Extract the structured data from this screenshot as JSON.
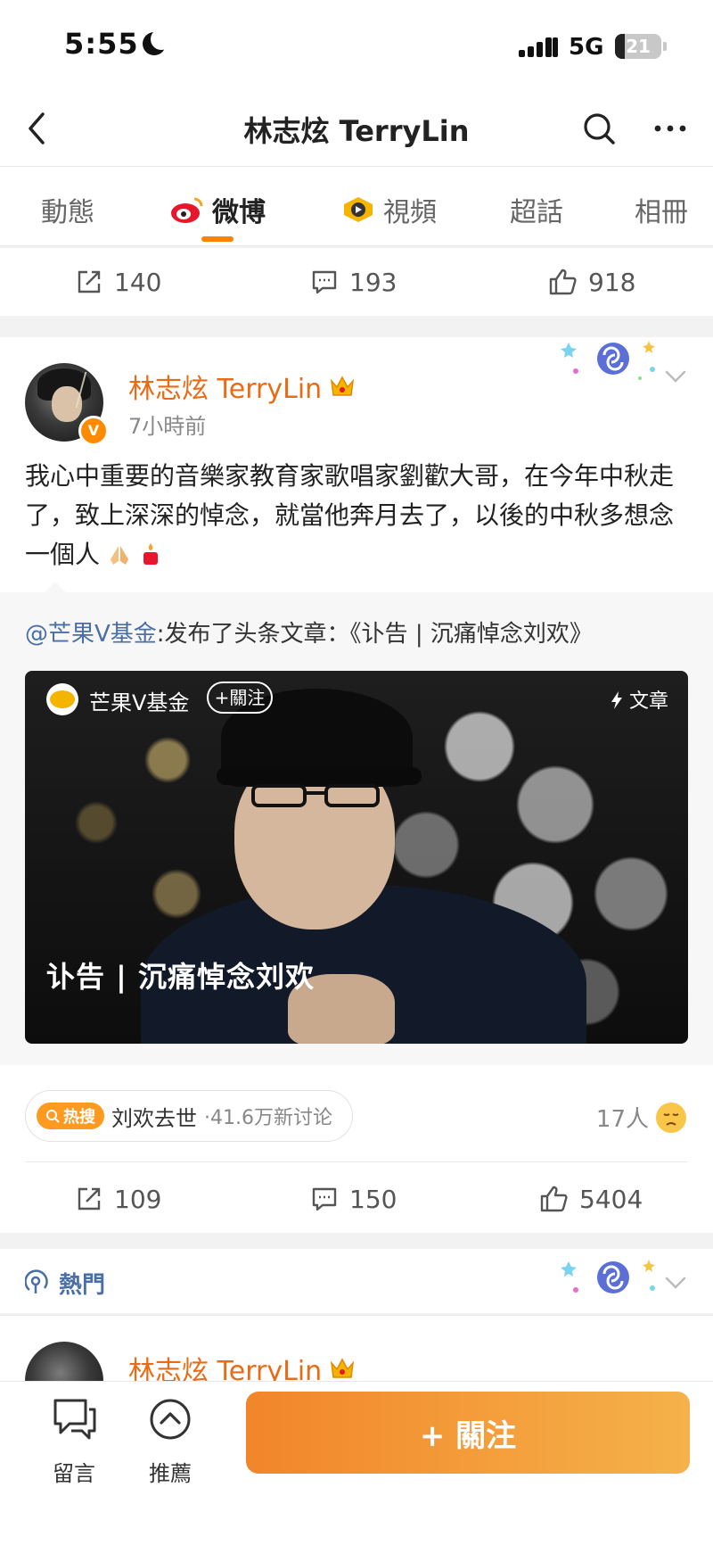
{
  "status_bar": {
    "time": "5:55",
    "network": "5G",
    "battery": "21",
    "battery_level": 0.21
  },
  "nav": {
    "title": "林志炫 TerryLin"
  },
  "tabs": [
    {
      "label": "動態",
      "active": false
    },
    {
      "label": "微博",
      "active": true
    },
    {
      "label": "視頻",
      "active": false
    },
    {
      "label": "超話",
      "active": false
    },
    {
      "label": "相冊",
      "active": false
    }
  ],
  "prev_post_actions": {
    "reposts": "140",
    "comments": "193",
    "likes": "918"
  },
  "post": {
    "author": "林志炫 TerryLin",
    "time": "7小時前",
    "text": "我心中重要的音樂家教育家歌唱家劉歡大哥，在今年中秋走了，致上深深的悼念，就當他奔月去了，以後的中秋多想念一個人",
    "repost": {
      "mention": "@芒果V基金",
      "text": ":发布了头条文章：《讣告 | 沉痛悼念刘欢》",
      "article_source": "芒果V基金",
      "follow_label": "+關注",
      "tag": "文章",
      "article_title": "讣告 | 沉痛悼念刘欢"
    },
    "trend": {
      "badge": "热搜",
      "topic": "刘欢去世",
      "meta": "·41.6万新讨论"
    },
    "people": "17人",
    "actions": {
      "reposts": "109",
      "comments": "150",
      "likes": "5404"
    }
  },
  "hot_section": {
    "label": "熱門"
  },
  "next_post": {
    "author": "林志炫 TerryLin"
  },
  "bottom_bar": {
    "comment_label": "留言",
    "recommend_label": "推薦",
    "follow_label": "+ 關注"
  },
  "colors": {
    "accent": "#ff8200",
    "username": "#e86b16",
    "link": "#4a6fa5"
  }
}
